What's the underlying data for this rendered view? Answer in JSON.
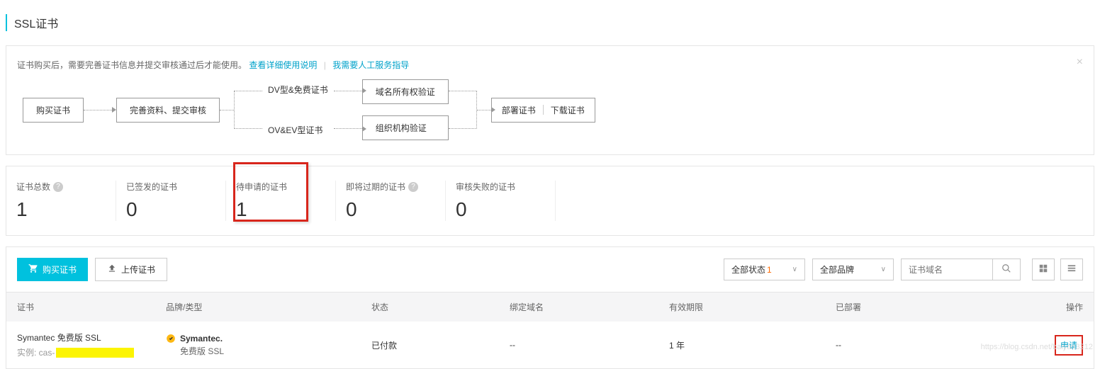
{
  "page": {
    "title": "SSL证书"
  },
  "info": {
    "text": "证书购买后，需要完善证书信息并提交审核通过后才能使用。",
    "link1": "查看详细使用说明",
    "link2": "我需要人工服务指导"
  },
  "flow": {
    "step1": "购买证书",
    "step2": "完善资料、提交审核",
    "branch_top_label": "DV型&免费证书",
    "branch_bot_label": "OV&EV型证书",
    "verify_top": "域名所有权验证",
    "verify_bot": "组织机构验证",
    "final_deploy": "部署证书",
    "final_download": "下载证书"
  },
  "stats": {
    "total": {
      "label": "证书总数",
      "value": "1"
    },
    "issued": {
      "label": "已签发的证书",
      "value": "0"
    },
    "pending": {
      "label": "待申请的证书",
      "value": "1"
    },
    "expiring": {
      "label": "即将过期的证书",
      "value": "0"
    },
    "failed": {
      "label": "审核失败的证书",
      "value": "0"
    }
  },
  "toolbar": {
    "buy": "购买证书",
    "upload": "上传证书",
    "filter_status": "全部状态",
    "filter_status_count": "1",
    "filter_brand": "全部品牌",
    "search_placeholder": "证书域名"
  },
  "table": {
    "headers": {
      "cert": "证书",
      "brand": "品牌/类型",
      "status": "状态",
      "domain": "绑定域名",
      "validity": "有效期限",
      "deployed": "已部署",
      "action": "操作"
    },
    "row": {
      "cert_name": "Symantec 免费版 SSL",
      "instance_prefix": "实例: cas-",
      "brand_name": "Symantec.",
      "brand_sub": "免费版 SSL",
      "status": "已付款",
      "domain": "--",
      "validity": "1 年",
      "deployed": "--",
      "action": "申请"
    }
  },
  "watermark": "https://blog.csdn.net/baiyan3212"
}
